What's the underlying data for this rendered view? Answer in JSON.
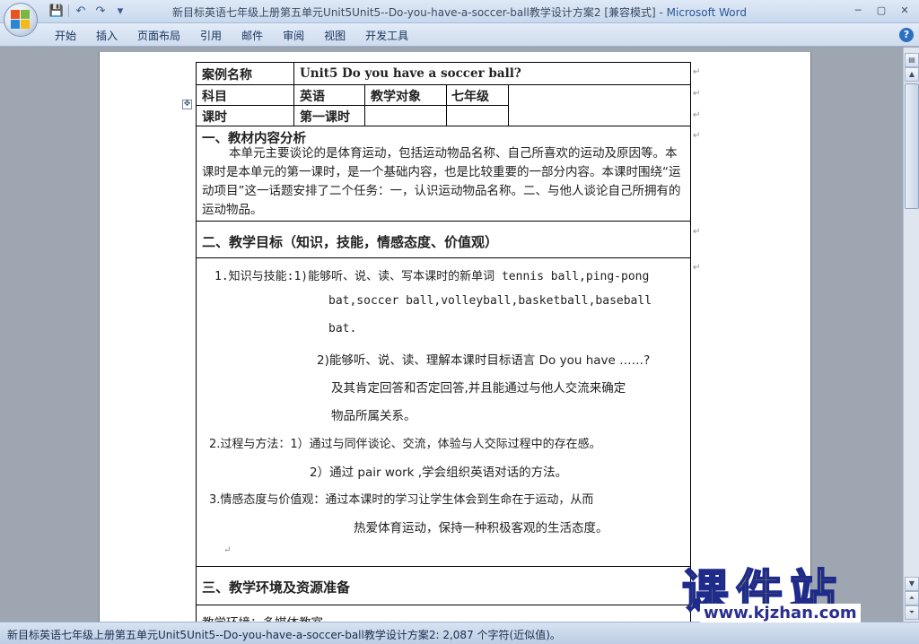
{
  "window": {
    "title_doc": "新目标英语七年级上册第五单元Unit5Unit5--Do-you-have-a-soccer-ball教学设计方案2 [兼容模式] - ",
    "title_app": "Microsoft Word"
  },
  "qat": {
    "save_icon": "💾",
    "undo_icon": "↶",
    "redo_icon": "↷",
    "more_icon": "▾"
  },
  "ribbon": {
    "tabs": [
      "开始",
      "插入",
      "页面布局",
      "引用",
      "邮件",
      "审阅",
      "视图",
      "开发工具"
    ],
    "help": "?"
  },
  "controls": {
    "minimize": "─",
    "maximize": "▢",
    "close": "✕"
  },
  "table": {
    "case_name_label": "案例名称",
    "case_name_value": "Unit5  Do you have a soccer ball?",
    "subject_label": "科目",
    "subject_value": "英语",
    "audience_label": "教学对象",
    "audience_value": "七年级",
    "period_label": "课时",
    "period_value": "第一课时",
    "section1_title": "一、教材内容分析",
    "section1_body": "本单元主要谈论的是体育运动，包括运动物品名称、自己所喜欢的运动及原因等。本课时是本单元的第一课时，是一个基础内容，也是比较重要的一部分内容。本课时围绕“运动项目”这一话题安排了二个任务：一，认识运动物品名称。二、与他人谈论自己所拥有的运动物品。",
    "section2_title": "二、教学目标（知识，技能，情感态度、价值观）",
    "obj_lines": [
      "1.知识与技能:1)能够听、说、读、写本课时的新单词 tennis ball,ping-pong",
      "bat,soccer     ball,volleyball,basketball,baseball",
      "bat.",
      "2)能够听、说、读、理解本课时目标语言 Do you have ……?",
      "及其肯定回答和否定回答,并且能通过与他人交流来确定",
      "物品所属关系。",
      "2.过程与方法：1）通过与同伴谈论、交流，体验与人交际过程中的存在感。",
      "2）通过 pair work ,学会组织英语对话的方法。",
      "3.情感态度与价值观：通过本课时的学习让学生体会到生命在于运动，从而",
      "热爱体育运动，保持一种积极客观的生活态度。"
    ],
    "section3_title": "三、教学环境及资源准备",
    "section3_body": "教学环境：多媒体教室"
  },
  "marks": {
    "para": "↵",
    "move": "✥"
  },
  "status": {
    "text": "新目标英语七年级上册第五单元Unit5Unit5--Do-you-have-a-soccer-ball教学设计方案2: 2,087 个字符(近似值)。"
  },
  "watermark": {
    "title": "课件站",
    "url": "www.kjzhan.com"
  }
}
